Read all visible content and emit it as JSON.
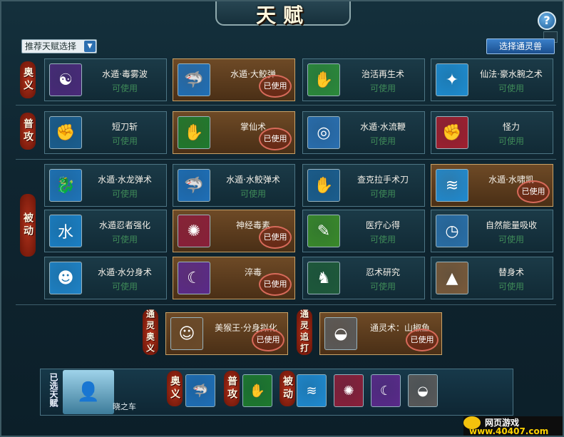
{
  "title": "天赋",
  "help_label": "?",
  "dropdown": {
    "value": "推荐天赋选择"
  },
  "choose_button": "选择通灵兽",
  "sections": {
    "ultimate": "奥义",
    "normal": "普攻",
    "passive": "被动",
    "summon_ultimate": "通灵奥义",
    "summon_pursuit": "通灵追打"
  },
  "status": {
    "available": "可使用",
    "used": "已使用"
  },
  "cards": [
    {
      "name": "水遁·毒雾波",
      "used": false,
      "icon": "mist-icon",
      "color": "#4a2a7a"
    },
    {
      "name": "水遁·大鲛弹",
      "used": true,
      "icon": "shark-icon",
      "color": "#1f6fb7"
    },
    {
      "name": "治活再生术",
      "used": false,
      "icon": "regen-icon",
      "color": "#2c8a3a"
    },
    {
      "name": "仙法·豪水腕之术",
      "used": false,
      "icon": "arm-icon",
      "color": "#1e8cd0"
    },
    {
      "name": "短刀斩",
      "used": false,
      "icon": "fist-icon",
      "color": "#1b5e8f"
    },
    {
      "name": "掌仙术",
      "used": true,
      "icon": "palm-icon",
      "color": "#1e7a2e"
    },
    {
      "name": "水遁·水流鞭",
      "used": false,
      "icon": "whip-icon",
      "color": "#2a6fb0"
    },
    {
      "name": "怪力",
      "used": false,
      "icon": "glove-icon",
      "color": "#a01f2f"
    },
    {
      "name": "水遁·水龙弹术",
      "used": false,
      "icon": "dragon-icon",
      "color": "#1f74b8"
    },
    {
      "name": "水遁·水鲛弹术",
      "used": false,
      "icon": "shark-icon",
      "color": "#1f6fb7"
    },
    {
      "name": "查克拉手术刀",
      "used": false,
      "icon": "hand-icon",
      "color": "#1b5e8f"
    },
    {
      "name": "水遁·水啸凯",
      "used": true,
      "icon": "wave-icon",
      "color": "#1f8ad0"
    },
    {
      "name": "水遁忍者强化",
      "used": false,
      "icon": "water-icon",
      "color": "#1a7fc4"
    },
    {
      "name": "神经毒素",
      "used": true,
      "icon": "brain-icon",
      "color": "#8a1f3a"
    },
    {
      "name": "医疗心得",
      "used": false,
      "icon": "needle-icon",
      "color": "#3a8a2a"
    },
    {
      "name": "自然能量吸收",
      "used": false,
      "icon": "clock-icon",
      "color": "#2a6fa8"
    },
    {
      "name": "水遁·水分身术",
      "used": false,
      "icon": "clone-icon",
      "color": "#1e82c6"
    },
    {
      "name": "淬毒",
      "used": true,
      "icon": "blade-icon",
      "color": "#5a2a8a"
    },
    {
      "name": "忍术研究",
      "used": false,
      "icon": "ninja-icon",
      "color": "#1e5a3a"
    },
    {
      "name": "替身术",
      "used": false,
      "icon": "log-icon",
      "color": "#7a5a3a"
    }
  ],
  "summon_cards": [
    {
      "name": "美猴王·分身拟化",
      "used": true,
      "icon": "monkey-icon",
      "color": "#6a4a2a"
    },
    {
      "name": "通灵术：山椒鱼",
      "used": true,
      "icon": "salamander-icon",
      "color": "#5a5a5a"
    }
  ],
  "chosen": {
    "label": "已选天赋",
    "character": "晓之车",
    "ultimate_label": "奥义",
    "normal_label": "普攻",
    "passive_label": "被动",
    "icons": [
      {
        "icon": "shark-icon",
        "color": "#1f6fb7"
      },
      {
        "icon": "palm-icon",
        "color": "#1e7a2e"
      },
      {
        "icon": "wave-icon",
        "color": "#1f8ad0"
      },
      {
        "icon": "brain-icon",
        "color": "#8a1f3a"
      },
      {
        "icon": "blade-icon",
        "color": "#5a2a8a"
      },
      {
        "icon": "salamander-icon",
        "color": "#5a5a5a"
      }
    ]
  },
  "logo": {
    "line1": "网页游戏",
    "line2": "www.40407.com"
  }
}
